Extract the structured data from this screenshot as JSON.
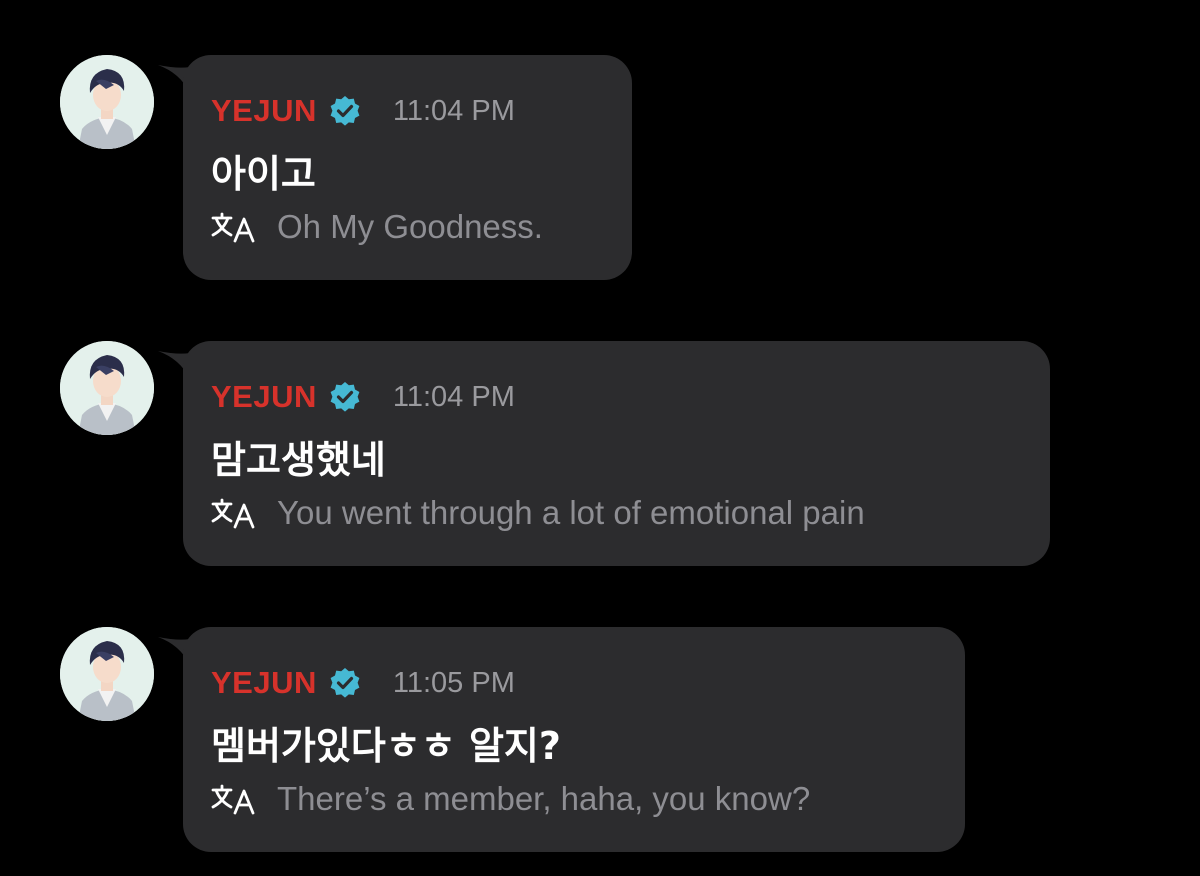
{
  "messages": [
    {
      "sender": "YEJUN",
      "time": "11:04 PM",
      "text": "아이고",
      "translation": "Oh My Goodness.",
      "verified": true
    },
    {
      "sender": "YEJUN",
      "time": "11:04 PM",
      "text": "맘고생했네",
      "translation": "You went through a lot of emotional pain",
      "verified": true
    },
    {
      "sender": "YEJUN",
      "time": "11:05 PM",
      "text": "멤버가있다ㅎㅎ 알지?",
      "translation": "There’s a member, haha, you know?",
      "verified": true
    }
  ],
  "icons": {
    "verified": "verified-badge-icon",
    "translate": "translate-icon"
  },
  "colors": {
    "background": "#000000",
    "bubble": "#2c2c2e",
    "name": "#d7322b",
    "verified": "#46b9d4",
    "timestamp": "#9a9a9e",
    "translation": "#8e8e93",
    "text": "#ffffff"
  }
}
